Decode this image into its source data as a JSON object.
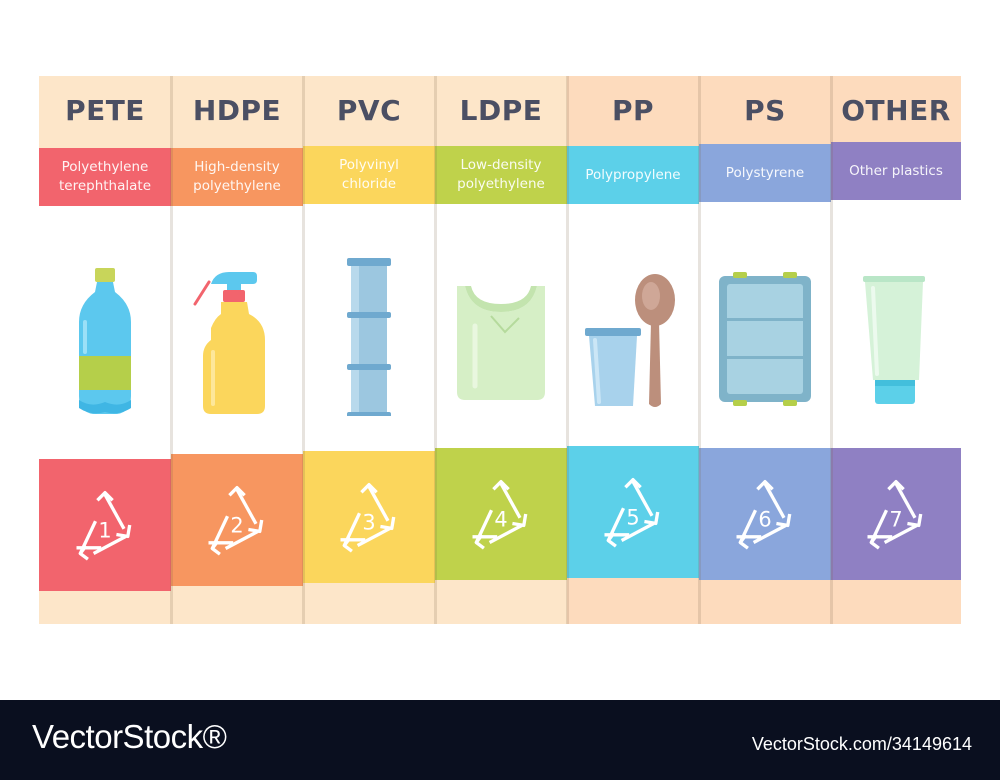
{
  "columns": [
    {
      "code": "PETE",
      "name_line1": "Polyethylene",
      "name_line2": "terephthalate",
      "number": "1",
      "color": "#f2646d",
      "top_color": "#fde6c9",
      "foot_color": "#fde6c9",
      "item": "bottle-icon"
    },
    {
      "code": "HDPE",
      "name_line1": "High-density",
      "name_line2": "polyethylene",
      "number": "2",
      "color": "#f79660",
      "top_color": "#fde6c9",
      "foot_color": "#fde6c9",
      "item": "spray-bottle-icon"
    },
    {
      "code": "PVC",
      "name_line1": "Polyvinyl",
      "name_line2": "chloride",
      "number": "3",
      "color": "#fbd65c",
      "top_color": "#fde6c9",
      "foot_color": "#fde6c9",
      "item": "pipe-icon"
    },
    {
      "code": "LDPE",
      "name_line1": "Low-density",
      "name_line2": "polyethylene",
      "number": "4",
      "color": "#bfd24b",
      "top_color": "#fde6c9",
      "foot_color": "#fde6c9",
      "item": "plastic-bag-icon"
    },
    {
      "code": "PP",
      "name_line1": "Polypropylene",
      "name_line2": "",
      "number": "5",
      "color": "#5cd0e9",
      "top_color": "#fddbbd",
      "foot_color": "#fddbbd",
      "item": "cup-and-spoon-icon"
    },
    {
      "code": "PS",
      "name_line1": "Polystyrene",
      "name_line2": "",
      "number": "6",
      "color": "#8aa6dc",
      "top_color": "#fddbbd",
      "foot_color": "#fddbbd",
      "item": "container-icon"
    },
    {
      "code": "OTHER",
      "name_line1": "Other plastics",
      "name_line2": "",
      "number": "7",
      "color": "#8f80c3",
      "top_color": "#fddbbd",
      "foot_color": "#fddbbd",
      "item": "tube-icon"
    }
  ],
  "footer": {
    "brand": "VectorStock®",
    "image_id": "VectorStock.com/34149614"
  }
}
